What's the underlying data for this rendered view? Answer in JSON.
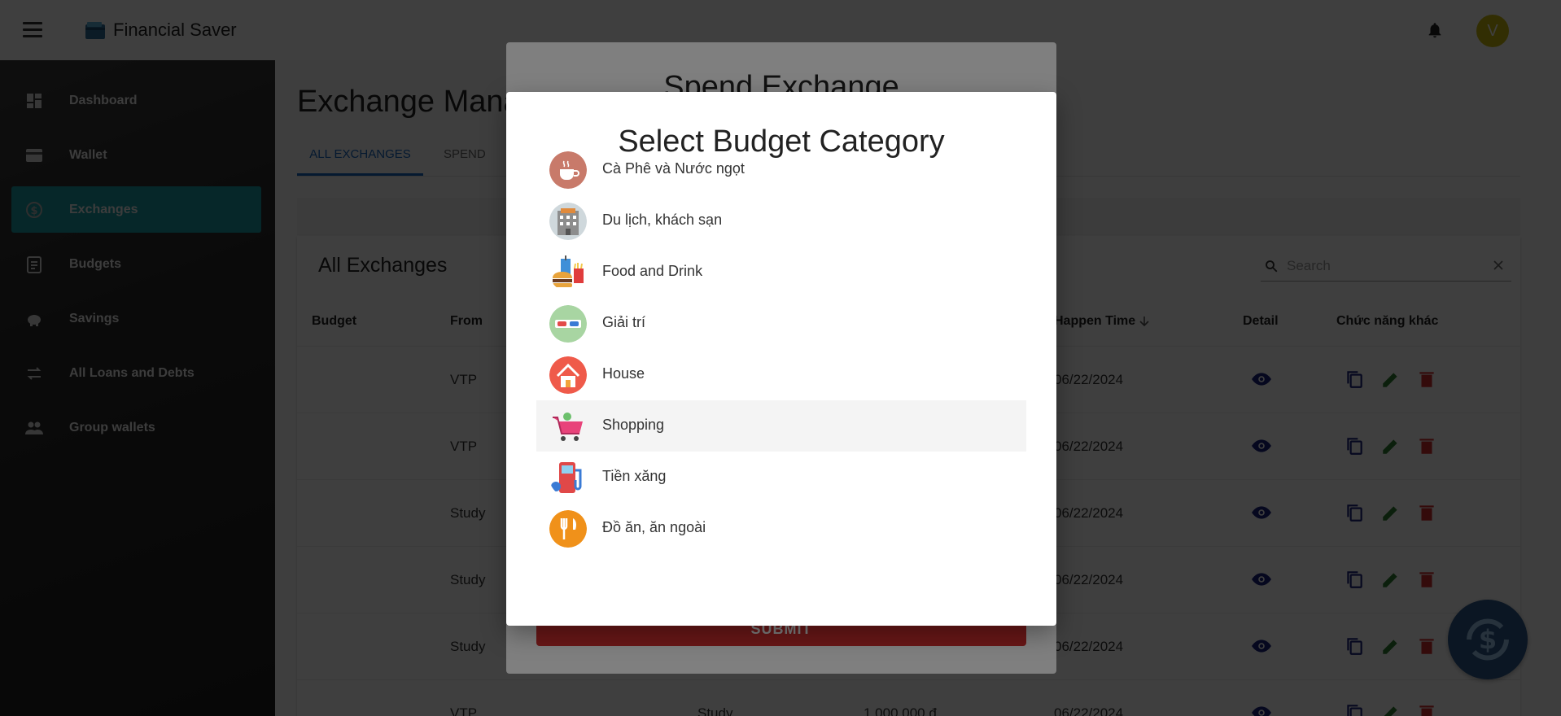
{
  "header": {
    "app_title": "Financial Saver",
    "avatar_initial": "V"
  },
  "sidebar": {
    "items": [
      {
        "label": "Dashboard",
        "icon": "dashboard-icon"
      },
      {
        "label": "Wallet",
        "icon": "wallet-icon"
      },
      {
        "label": "Exchanges",
        "icon": "exchange-icon",
        "active": true
      },
      {
        "label": "Budgets",
        "icon": "budget-icon"
      },
      {
        "label": "Savings",
        "icon": "piggy-bank-icon"
      },
      {
        "label": "All Loans and Debts",
        "icon": "swap-arrows-icon"
      },
      {
        "label": "Group wallets",
        "icon": "group-icon"
      }
    ]
  },
  "main": {
    "page_title": "Exchange Mana",
    "tabs": [
      {
        "label": "ALL EXCHANGES"
      },
      {
        "label": "SPEND"
      }
    ],
    "card_title": "All Exchanges",
    "search_placeholder": "Search",
    "columns": {
      "budget": "Budget",
      "from": "From",
      "happen_time": "Happen Time",
      "detail": "Detail",
      "other": "Chức năng khác"
    },
    "rows": [
      {
        "from": "VTP",
        "to": "",
        "amount": "",
        "date": "06/22/2024"
      },
      {
        "from": "VTP",
        "to": "",
        "amount": "",
        "date": "06/22/2024"
      },
      {
        "from": "Study",
        "to": "",
        "amount": "",
        "date": "06/22/2024"
      },
      {
        "from": "Study",
        "to": "",
        "amount": "",
        "date": "06/22/2024"
      },
      {
        "from": "Study",
        "to": "",
        "amount": "",
        "date": "06/22/2024"
      },
      {
        "from": "VTP",
        "to": "Study",
        "amount": "1.000.000 đ",
        "date": "06/22/2024"
      }
    ]
  },
  "back_dialog": {
    "title": "Spend Exchange",
    "submit_label": "SUBMIT"
  },
  "dialog": {
    "title": "Select Budget Category",
    "categories": [
      {
        "label": "Cà Phê và Nước ngọt",
        "icon": "coffee-cup-icon"
      },
      {
        "label": "Du lịch, khách sạn",
        "icon": "hotel-icon"
      },
      {
        "label": "Food and Drink",
        "icon": "fast-food-icon"
      },
      {
        "label": "Giải trí",
        "icon": "3d-glasses-icon"
      },
      {
        "label": "House",
        "icon": "house-icon"
      },
      {
        "label": "Shopping",
        "icon": "shopping-cart-icon",
        "highlighted": true
      },
      {
        "label": "Tiền xăng",
        "icon": "gas-pump-icon"
      },
      {
        "label": "Đồ ăn, ăn ngoài",
        "icon": "fork-knife-icon"
      }
    ]
  },
  "colors": {
    "accent": "#1a9ea6",
    "tab_active": "#1565c0",
    "danger": "#d32f2f",
    "edit": "#2e7d32",
    "detail": "#1a237e"
  }
}
